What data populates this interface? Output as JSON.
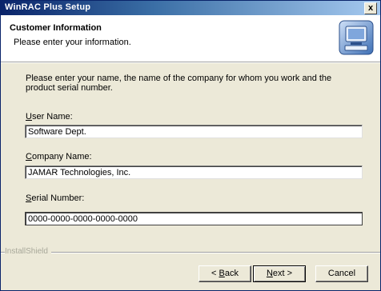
{
  "window": {
    "title": "WinRAC Plus Setup",
    "close_glyph": "x"
  },
  "header": {
    "title": "Customer Information",
    "subtitle": "Please enter your information.",
    "icon": "setup-computer-icon"
  },
  "intro_text": "Please enter your name, the name of the company for whom you work and the product serial number.",
  "fields": {
    "user_name": {
      "label_first": "U",
      "label_rest": "ser Name:",
      "value": "Software Dept."
    },
    "company_name": {
      "label_first": "C",
      "label_rest": "ompany Name:",
      "value": "JAMAR Technologies, Inc."
    },
    "serial_number": {
      "label_first": "S",
      "label_rest": "erial Number:",
      "value": "0000-0000-0000-0000-0000"
    }
  },
  "footer": {
    "brand": "InstallShield"
  },
  "buttons": {
    "back": {
      "prefix": "< ",
      "underline": "B",
      "rest": "ack"
    },
    "next": {
      "underline": "N",
      "rest": "ext >"
    },
    "cancel": {
      "label": "Cancel"
    }
  }
}
